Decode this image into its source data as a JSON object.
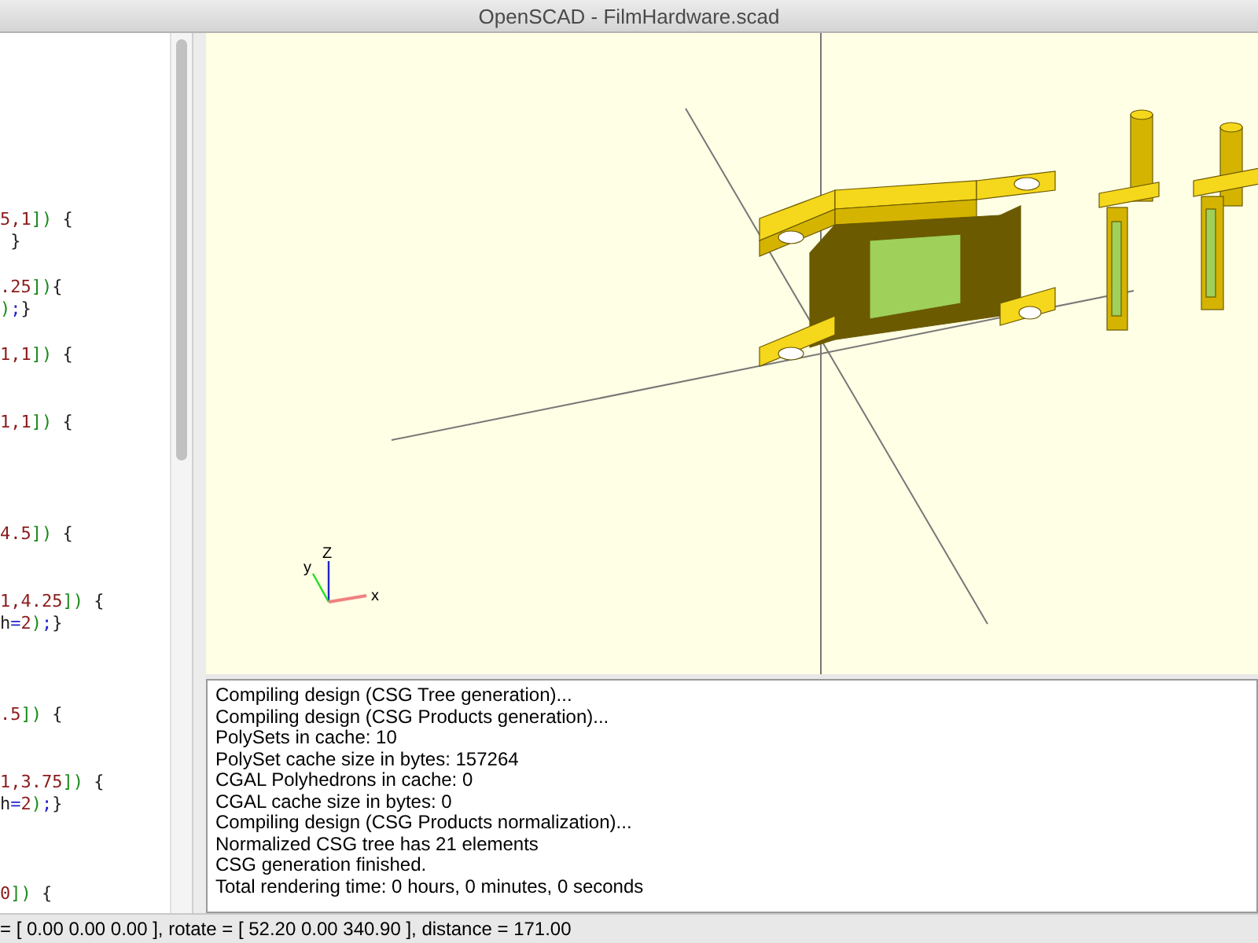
{
  "window": {
    "title": "OpenSCAD - FilmHardware.scad"
  },
  "editor": {
    "lines": [
      {
        "kind": "blank"
      },
      {
        "kind": "blank"
      },
      {
        "kind": "blank"
      },
      {
        "kind": "blank"
      },
      {
        "kind": "blank"
      },
      {
        "kind": "blank"
      },
      {
        "kind": "blank"
      },
      {
        "kind": "code",
        "text": "5,1]) {"
      },
      {
        "kind": "code",
        "text": " }"
      },
      {
        "kind": "blank"
      },
      {
        "kind": "code",
        "text": ".25]){"
      },
      {
        "kind": "code",
        "text": ");}"
      },
      {
        "kind": "blank"
      },
      {
        "kind": "code",
        "text": "1,1]) {"
      },
      {
        "kind": "blank"
      },
      {
        "kind": "blank"
      },
      {
        "kind": "code",
        "text": "1,1]) {"
      },
      {
        "kind": "blank"
      },
      {
        "kind": "blank"
      },
      {
        "kind": "blank"
      },
      {
        "kind": "blank"
      },
      {
        "kind": "code",
        "text": "4.5]) {"
      },
      {
        "kind": "blank"
      },
      {
        "kind": "blank"
      },
      {
        "kind": "code",
        "text": "1,4.25]) {"
      },
      {
        "kind": "code",
        "text": "h=2);}"
      },
      {
        "kind": "blank"
      },
      {
        "kind": "blank"
      },
      {
        "kind": "blank"
      },
      {
        "kind": "code",
        "text": ".5]) {"
      },
      {
        "kind": "blank"
      },
      {
        "kind": "blank"
      },
      {
        "kind": "code",
        "text": "1,3.75]) {"
      },
      {
        "kind": "code",
        "text": "h=2);}"
      },
      {
        "kind": "blank"
      },
      {
        "kind": "blank"
      },
      {
        "kind": "blank"
      },
      {
        "kind": "code",
        "text": "0]) {"
      }
    ]
  },
  "viewport": {
    "axis_labels": [
      "Z",
      "y",
      "x"
    ]
  },
  "console": {
    "lines": [
      "Compiling design (CSG Tree generation)...",
      "Compiling design (CSG Products generation)...",
      "PolySets in cache: 10",
      "PolySet cache size in bytes: 157264",
      "CGAL Polyhedrons in cache: 0",
      "CGAL cache size in bytes: 0",
      "Compiling design (CSG Products normalization)...",
      "Normalized CSG tree has 21 elements",
      "CSG generation finished.",
      "Total rendering time: 0 hours, 0 minutes, 0 seconds"
    ]
  },
  "status_bar": {
    "text": "= [ 0.00 0.00 0.00 ], rotate = [ 52.20 0.00 340.90 ], distance = 171.00"
  }
}
